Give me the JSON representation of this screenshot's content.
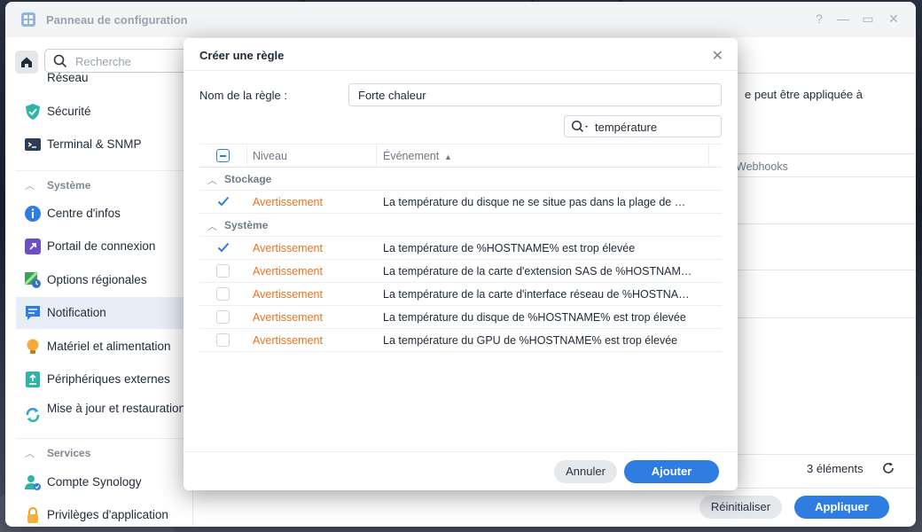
{
  "window": {
    "title": "Panneau de configuration",
    "controls": [
      "?",
      "—",
      "▭",
      "✕"
    ]
  },
  "sidebar": {
    "search_placeholder": "Recherche",
    "partial_top_label": "Réseau",
    "items_top": [
      {
        "label": "Sécurité",
        "icon": "shield-icon"
      },
      {
        "label": "Terminal & SNMP",
        "icon": "terminal-icon"
      }
    ],
    "section_system": "Système",
    "items_system": [
      {
        "label": "Centre d'infos",
        "icon": "info-icon"
      },
      {
        "label": "Portail de connexion",
        "icon": "login-portal-icon"
      },
      {
        "label": "Options régionales",
        "icon": "regional-options-icon"
      },
      {
        "label": "Notification",
        "icon": "notification-icon"
      },
      {
        "label": "Matériel et alimentation",
        "icon": "hardware-power-icon"
      },
      {
        "label": "Périphériques externes",
        "icon": "external-devices-icon"
      },
      {
        "label": "Mise à jour et restauration",
        "icon": "update-restore-icon"
      }
    ],
    "section_services": "Services",
    "items_services": [
      {
        "label": "Compte Synology",
        "icon": "synology-account-icon"
      },
      {
        "label": "Privilèges d'application",
        "icon": "app-privileges-icon"
      }
    ]
  },
  "background": {
    "text_partial": "e peut être appliquée à",
    "webhooks_label": "Webhooks",
    "count_label": "3 éléments",
    "reset_button": "Réinitialiser",
    "apply_button": "Appliquer"
  },
  "dialog": {
    "title": "Créer une règle",
    "rule_name_label": "Nom de la règle :",
    "rule_name_value": "Forte chaleur",
    "filter_value": "température",
    "columns": {
      "level": "Niveau",
      "event": "Événement"
    },
    "groups": [
      {
        "name": "Stockage",
        "rows": [
          {
            "checked": true,
            "level": "Avertissement",
            "event": "La température du disque ne se situe pas dans la plage de …"
          }
        ]
      },
      {
        "name": "Système",
        "rows": [
          {
            "checked": true,
            "level": "Avertissement",
            "event": "La température de %HOSTNAME% est trop élevée"
          },
          {
            "checked": false,
            "level": "Avertissement",
            "event": "La température de la carte d'extension SAS de %HOSTNAM…"
          },
          {
            "checked": false,
            "level": "Avertissement",
            "event": "La température de la carte d'interface réseau de %HOSTNA…"
          },
          {
            "checked": false,
            "level": "Avertissement",
            "event": "La température du disque de %HOSTNAME% est trop élevée"
          },
          {
            "checked": false,
            "level": "Avertissement",
            "event": "La température du GPU de %HOSTNAME% est trop élevée"
          }
        ]
      }
    ],
    "cancel_button": "Annuler",
    "add_button": "Ajouter"
  },
  "colors": {
    "accent": "#2f7de1",
    "warning": "#e8731e",
    "active_item_bg": "#e7eef8"
  }
}
